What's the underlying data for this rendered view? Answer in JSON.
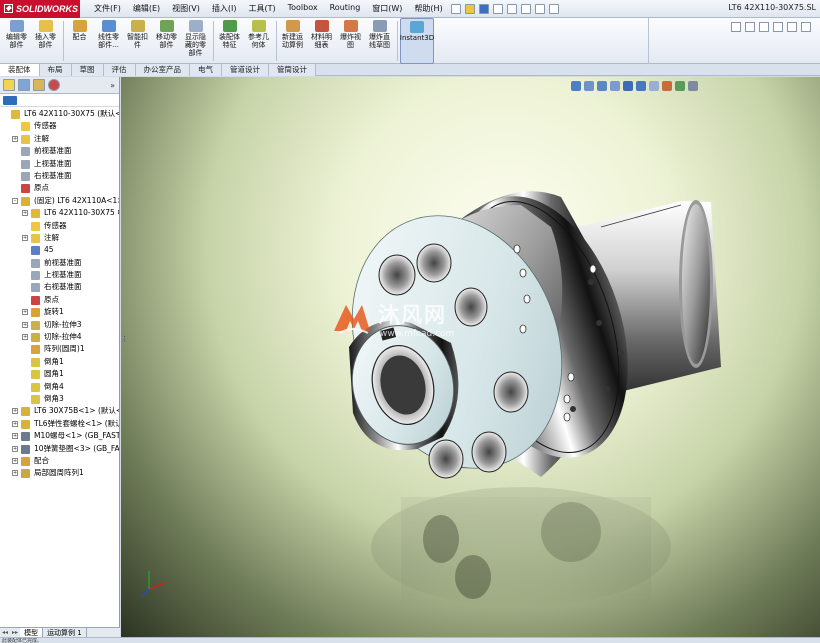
{
  "app": {
    "logo_text": "SOLIDWORKS",
    "document_title": "LT6 42X110-30X75.SL"
  },
  "menu": [
    "文件(F)",
    "编辑(E)",
    "视图(V)",
    "插入(I)",
    "工具(T)",
    "Toolbox",
    "Routing",
    "窗口(W)",
    "帮助(H)"
  ],
  "commands": [
    {
      "label": "编辑零\n部件",
      "color": "#7d9fcf"
    },
    {
      "label": "插入零\n部件",
      "color": "#e6c14a"
    },
    {
      "label": "配合",
      "color": "#d6a33e"
    },
    {
      "label": "线性零\n部件...",
      "color": "#5b8ed0"
    },
    {
      "label": "智能扣\n件",
      "color": "#c9b04a"
    },
    {
      "label": "移动零\n部件",
      "color": "#6fa35a"
    },
    {
      "label": "显示隐\n藏的零\n部件",
      "color": "#9bb0c8"
    },
    {
      "label": "装配体\n特征",
      "color": "#4e9b4b"
    },
    {
      "label": "参考几\n何体",
      "color": "#b7c04a"
    },
    {
      "label": "新建运\n动算例",
      "color": "#d09a4c"
    },
    {
      "label": "材料明\n细表",
      "color": "#c4553e"
    },
    {
      "label": "爆炸视\n图",
      "color": "#d4784a"
    },
    {
      "label": "爆炸直\n线草图",
      "color": "#8a9cb5"
    },
    {
      "label": "Instant3D",
      "color": "#5aa6d6"
    }
  ],
  "tabs": [
    "装配体",
    "布局",
    "草图",
    "评估",
    "办公室产品",
    "电气",
    "管道设计",
    "管筒设计"
  ],
  "tree": [
    {
      "label": "LT6 42X110-30X75 (默认<默认",
      "indent": 0,
      "exp": "",
      "color": "#e0b83a"
    },
    {
      "label": "传感器",
      "indent": 1,
      "exp": "",
      "color": "#f0c640"
    },
    {
      "label": "注解",
      "indent": 1,
      "exp": "+",
      "color": "#e9c24a"
    },
    {
      "label": "前视基准面",
      "indent": 1,
      "exp": "",
      "color": "#9aa7b8"
    },
    {
      "label": "上视基准面",
      "indent": 1,
      "exp": "",
      "color": "#9aa7b8"
    },
    {
      "label": "右视基准面",
      "indent": 1,
      "exp": "",
      "color": "#9aa7b8"
    },
    {
      "label": "原点",
      "indent": 1,
      "exp": "",
      "color": "#c44"
    },
    {
      "label": "(固定) LT6 42X110A<1> (默",
      "indent": 1,
      "exp": "-",
      "color": "#d8b040"
    },
    {
      "label": "LT6 42X110-30X75 中的",
      "indent": 2,
      "exp": "+",
      "color": "#e0b83a"
    },
    {
      "label": "传感器",
      "indent": 2,
      "exp": "",
      "color": "#f0c640"
    },
    {
      "label": "注解",
      "indent": 2,
      "exp": "+",
      "color": "#e9c24a"
    },
    {
      "label": "45",
      "indent": 2,
      "exp": "",
      "color": "#5b7fc0"
    },
    {
      "label": "前视基准面",
      "indent": 2,
      "exp": "",
      "color": "#9aa7b8"
    },
    {
      "label": "上视基准面",
      "indent": 2,
      "exp": "",
      "color": "#9aa7b8"
    },
    {
      "label": "右视基准面",
      "indent": 2,
      "exp": "",
      "color": "#9aa7b8"
    },
    {
      "label": "原点",
      "indent": 2,
      "exp": "",
      "color": "#c44"
    },
    {
      "label": "旋转1",
      "indent": 2,
      "exp": "+",
      "color": "#d8a040"
    },
    {
      "label": "切除-拉伸3",
      "indent": 2,
      "exp": "+",
      "color": "#c9b04a"
    },
    {
      "label": "切除-拉伸4",
      "indent": 2,
      "exp": "+",
      "color": "#c9b04a"
    },
    {
      "label": "阵列(圆周)1",
      "indent": 2,
      "exp": "",
      "color": "#d6a33e"
    },
    {
      "label": "倒角1",
      "indent": 2,
      "exp": "",
      "color": "#d9c540"
    },
    {
      "label": "圆角1",
      "indent": 2,
      "exp": "",
      "color": "#d9c540"
    },
    {
      "label": "倒角4",
      "indent": 2,
      "exp": "",
      "color": "#d9c540"
    },
    {
      "label": "倒角3",
      "indent": 2,
      "exp": "",
      "color": "#d9c540"
    },
    {
      "label": "LT6 30X75B<1> (默认<<默",
      "indent": 1,
      "exp": "+",
      "color": "#d8b040"
    },
    {
      "label": "TL6弹性套螺栓<1> (默认<-",
      "indent": 1,
      "exp": "+",
      "color": "#d8b040"
    },
    {
      "label": "M10螺母<1> (GB_FASTEN",
      "indent": 1,
      "exp": "+",
      "color": "#6b7b8c"
    },
    {
      "label": "10弹簧垫圈<3> (GB_FASTE",
      "indent": 1,
      "exp": "+",
      "color": "#6b7b8c"
    },
    {
      "label": "配合",
      "indent": 1,
      "exp": "+",
      "color": "#d6a33e"
    },
    {
      "label": "局部圆周阵列1",
      "indent": 1,
      "exp": "+",
      "color": "#c9a64a"
    }
  ],
  "model_tabs": [
    "模型",
    "运动算例 1"
  ],
  "statusbar_text": "此装配体已完成。",
  "watermark": {
    "name": "沐风网",
    "url": "www.mfcad.com"
  }
}
